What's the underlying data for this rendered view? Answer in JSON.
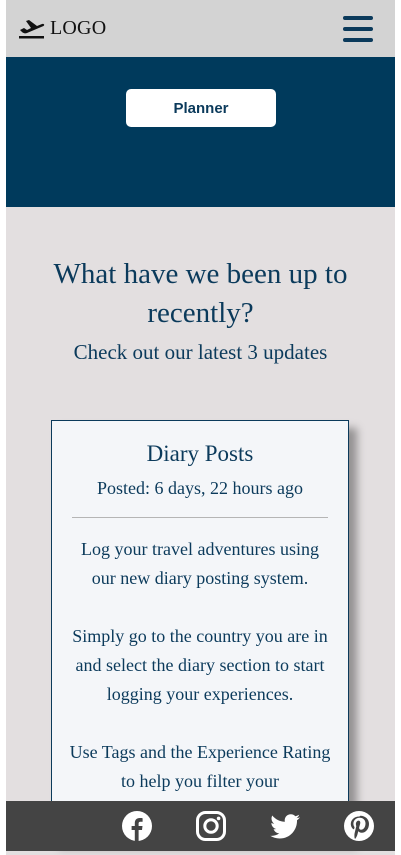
{
  "navbar": {
    "logo_text": "LOGO",
    "logo_icon": "plane-icon",
    "menu_icon": "hamburger-menu-icon"
  },
  "hero": {
    "planner_label": "Planner",
    "background_color": "#003a5c"
  },
  "updates": {
    "heading": "What have we been up to recently?",
    "subheading": "Check out our latest 3 updates"
  },
  "card": {
    "title": "Diary Posts",
    "posted": "Posted: 6 days, 22 hours ago",
    "paragraphs": [
      "Log your travel adventures using our new diary posting system.",
      "Simply go to the country you are in and select the diary section to start logging your experiences.",
      "Use Tags and the Experience Rating to help you filter your"
    ]
  },
  "social": {
    "icons": [
      "facebook-icon",
      "instagram-icon",
      "twitter-icon",
      "pinterest-icon"
    ],
    "bar_color": "#444444"
  },
  "colors": {
    "accent": "#0b3a5b",
    "page_background": "#e3dfe0",
    "navbar_background": "#d3d3d3"
  }
}
